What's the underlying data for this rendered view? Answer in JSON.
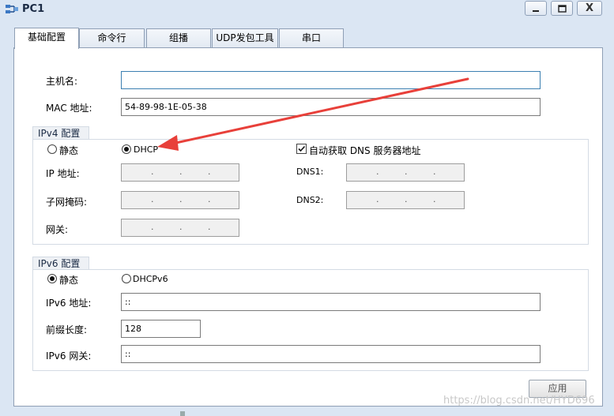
{
  "window": {
    "title": "PC1",
    "min_icon": "minimize-icon",
    "max_icon": "maximize-icon",
    "close_label": "X"
  },
  "tabs": [
    {
      "label": "基础配置",
      "active": true
    },
    {
      "label": "命令行",
      "active": false
    },
    {
      "label": "组播",
      "active": false
    },
    {
      "label": "UDP发包工具",
      "active": false
    },
    {
      "label": "串口",
      "active": false
    }
  ],
  "basic": {
    "hostname_label": "主机名:",
    "hostname_value": "",
    "mac_label": "MAC 地址:",
    "mac_value": "54-89-98-1E-05-38"
  },
  "ipv4": {
    "section_title": "IPv4 配置",
    "static_label": "静态",
    "dhcp_label": "DHCP",
    "selected": "DHCP",
    "auto_dns_label": "自动获取 DNS 服务器地址",
    "auto_dns_checked": true,
    "ip_label": "IP 地址:",
    "mask_label": "子网掩码:",
    "gateway_label": "网关:",
    "dns1_label": "DNS1:",
    "dns2_label": "DNS2:",
    "ip_dots": ".        .        ."
  },
  "ipv6": {
    "section_title": "IPv6 配置",
    "static_label": "静态",
    "dhcp_label": "DHCPv6",
    "selected": "静态",
    "ip_label": "IPv6 地址:",
    "ip_value": "::",
    "prefix_label": "前缀长度:",
    "prefix_value": "128",
    "gateway_label": "IPv6 网关:",
    "gateway_value": "::"
  },
  "apply_label": "应用",
  "watermark": "https://blog.csdn.net/HYD696",
  "colors": {
    "annotation_arrow": "#e8403a",
    "focus_border": "#3c7fb1"
  }
}
